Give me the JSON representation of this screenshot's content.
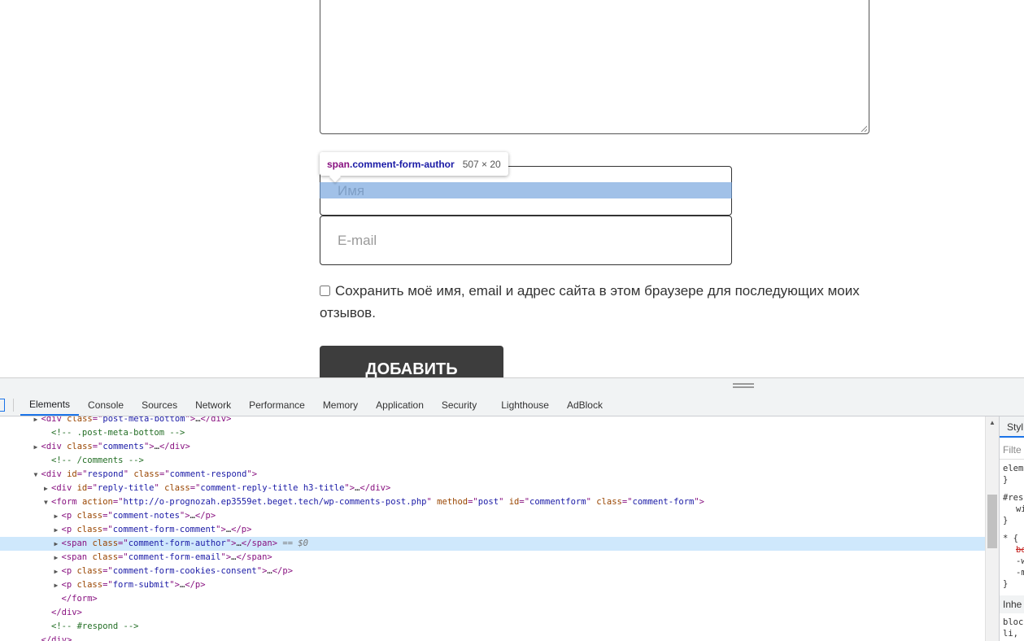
{
  "form": {
    "name_placeholder": "Имя",
    "email_placeholder": "E-mail",
    "consent_label": "Сохранить моё имя, email и адрес сайта в этом браузере для последующих моих отзывов.",
    "submit_label": "ДОБАВИТЬ"
  },
  "tooltip": {
    "tag": "span",
    "class_name": ".comment-form-author",
    "size": "507 × 20"
  },
  "devtools": {
    "tabs": [
      "Elements",
      "Console",
      "Sources",
      "Network",
      "Performance",
      "Memory",
      "Application",
      "Security",
      "Lighthouse",
      "AdBlock"
    ],
    "active_tab": "Elements",
    "selected_suffix": "== $0",
    "styles_tab": "Styl",
    "styles_filter": "Filte",
    "styles_lines": [
      "elem",
      "}",
      "#res",
      "wi",
      "}",
      "* {",
      "bo",
      "-w",
      "-m",
      "}"
    ],
    "inherited_label": "Inhe",
    "styles_bottom": [
      "bloc",
      "li,"
    ],
    "dom": [
      {
        "indent": 3,
        "tri": "▶",
        "parts": [
          [
            "t",
            "<div "
          ],
          [
            "an",
            "class"
          ],
          [
            "t",
            "=\""
          ],
          [
            "av",
            "post-meta-bottom"
          ],
          [
            "t",
            "\">"
          ],
          [
            "p",
            "…"
          ],
          [
            "t",
            "</div>"
          ]
        ]
      },
      {
        "indent": 4,
        "tri": "",
        "parts": [
          [
            "cm",
            "<!-- .post-meta-bottom -->"
          ]
        ]
      },
      {
        "indent": 3,
        "tri": "▶",
        "parts": [
          [
            "t",
            "<div "
          ],
          [
            "an",
            "class"
          ],
          [
            "t",
            "=\""
          ],
          [
            "av",
            "comments"
          ],
          [
            "t",
            "\">"
          ],
          [
            "p",
            "…"
          ],
          [
            "t",
            "</div>"
          ]
        ]
      },
      {
        "indent": 4,
        "tri": "",
        "parts": [
          [
            "cm",
            "<!-- /comments -->"
          ]
        ]
      },
      {
        "indent": 3,
        "tri": "▼",
        "parts": [
          [
            "t",
            "<div "
          ],
          [
            "an",
            "id"
          ],
          [
            "t",
            "=\""
          ],
          [
            "av",
            "respond"
          ],
          [
            "t",
            "\" "
          ],
          [
            "an",
            "class"
          ],
          [
            "t",
            "=\""
          ],
          [
            "av",
            "comment-respond"
          ],
          [
            "t",
            "\">"
          ]
        ]
      },
      {
        "indent": 4,
        "tri": "▶",
        "parts": [
          [
            "t",
            "<div "
          ],
          [
            "an",
            "id"
          ],
          [
            "t",
            "=\""
          ],
          [
            "av",
            "reply-title"
          ],
          [
            "t",
            "\" "
          ],
          [
            "an",
            "class"
          ],
          [
            "t",
            "=\""
          ],
          [
            "av",
            "comment-reply-title h3-title"
          ],
          [
            "t",
            "\">"
          ],
          [
            "p",
            "…"
          ],
          [
            "t",
            "</div>"
          ]
        ]
      },
      {
        "indent": 4,
        "tri": "▼",
        "parts": [
          [
            "t",
            "<form "
          ],
          [
            "an",
            "action"
          ],
          [
            "t",
            "=\""
          ],
          [
            "av",
            "http://o-prognozah.ep3559et.beget.tech/wp-comments-post.php"
          ],
          [
            "t",
            "\" "
          ],
          [
            "an",
            "method"
          ],
          [
            "t",
            "=\""
          ],
          [
            "av",
            "post"
          ],
          [
            "t",
            "\" "
          ],
          [
            "an",
            "id"
          ],
          [
            "t",
            "=\""
          ],
          [
            "av",
            "commentform"
          ],
          [
            "t",
            "\" "
          ],
          [
            "an",
            "class"
          ],
          [
            "t",
            "=\""
          ],
          [
            "av",
            "comment-form"
          ],
          [
            "t",
            "\">"
          ]
        ]
      },
      {
        "indent": 5,
        "tri": "▶",
        "parts": [
          [
            "t",
            "<p "
          ],
          [
            "an",
            "class"
          ],
          [
            "t",
            "=\""
          ],
          [
            "av",
            "comment-notes"
          ],
          [
            "t",
            "\">"
          ],
          [
            "p",
            "…"
          ],
          [
            "t",
            "</p>"
          ]
        ]
      },
      {
        "indent": 5,
        "tri": "▶",
        "parts": [
          [
            "t",
            "<p "
          ],
          [
            "an",
            "class"
          ],
          [
            "t",
            "=\""
          ],
          [
            "av",
            "comment-form-comment"
          ],
          [
            "t",
            "\">"
          ],
          [
            "p",
            "…"
          ],
          [
            "t",
            "</p>"
          ]
        ]
      },
      {
        "indent": 5,
        "tri": "▶",
        "selected": true,
        "parts": [
          [
            "t",
            "<span "
          ],
          [
            "an",
            "class"
          ],
          [
            "t",
            "=\""
          ],
          [
            "av",
            "comment-form-author"
          ],
          [
            "t",
            "\">"
          ],
          [
            "p",
            "…"
          ],
          [
            "t",
            "</span>"
          ]
        ]
      },
      {
        "indent": 5,
        "tri": "▶",
        "parts": [
          [
            "t",
            "<span "
          ],
          [
            "an",
            "class"
          ],
          [
            "t",
            "=\""
          ],
          [
            "av",
            "comment-form-email"
          ],
          [
            "t",
            "\">"
          ],
          [
            "p",
            "…"
          ],
          [
            "t",
            "</span>"
          ]
        ]
      },
      {
        "indent": 5,
        "tri": "▶",
        "parts": [
          [
            "t",
            "<p "
          ],
          [
            "an",
            "class"
          ],
          [
            "t",
            "=\""
          ],
          [
            "av",
            "comment-form-cookies-consent"
          ],
          [
            "t",
            "\">"
          ],
          [
            "p",
            "…"
          ],
          [
            "t",
            "</p>"
          ]
        ]
      },
      {
        "indent": 5,
        "tri": "▶",
        "parts": [
          [
            "t",
            "<p "
          ],
          [
            "an",
            "class"
          ],
          [
            "t",
            "=\""
          ],
          [
            "av",
            "form-submit"
          ],
          [
            "t",
            "\">"
          ],
          [
            "p",
            "…"
          ],
          [
            "t",
            "</p>"
          ]
        ]
      },
      {
        "indent": 5,
        "tri": "",
        "parts": [
          [
            "t",
            "</form>"
          ]
        ]
      },
      {
        "indent": 4,
        "tri": "",
        "parts": [
          [
            "t",
            "</div>"
          ]
        ]
      },
      {
        "indent": 4,
        "tri": "",
        "parts": [
          [
            "cm",
            "<!-- #respond -->"
          ]
        ]
      },
      {
        "indent": 3,
        "tri": "",
        "parts": [
          [
            "t",
            "</div>"
          ]
        ]
      }
    ]
  }
}
